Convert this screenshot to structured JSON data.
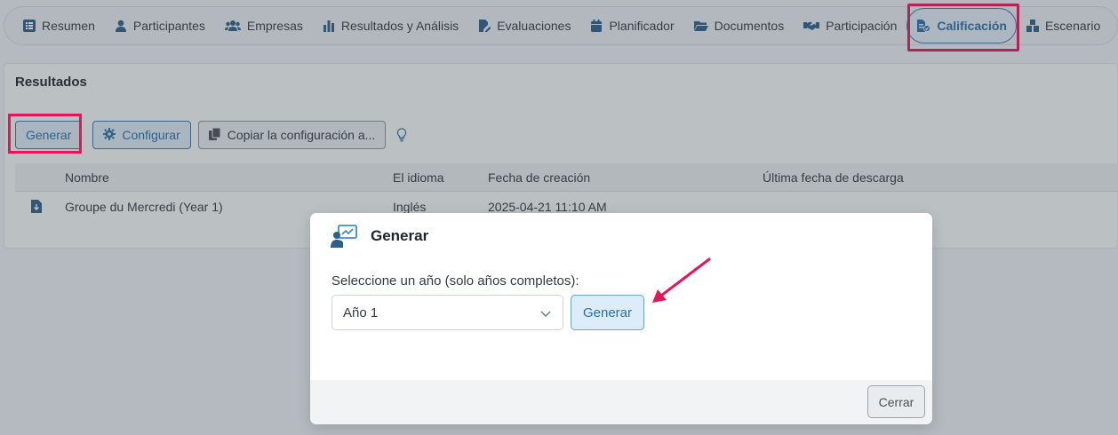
{
  "nav": {
    "items": [
      {
        "label": "Resumen",
        "icon": "list-icon"
      },
      {
        "label": "Participantes",
        "icon": "user-icon"
      },
      {
        "label": "Empresas",
        "icon": "users-icon"
      },
      {
        "label": "Resultados y Análisis",
        "icon": "bar-chart-icon"
      },
      {
        "label": "Evaluaciones",
        "icon": "file-edit-icon"
      },
      {
        "label": "Planificador",
        "icon": "calendar-icon"
      },
      {
        "label": "Documentos",
        "icon": "folder-icon"
      },
      {
        "label": "Participación",
        "icon": "handshake-icon"
      },
      {
        "label": "Calificación",
        "icon": "file-grade-icon",
        "active": true
      },
      {
        "label": "Escenario",
        "icon": "cubes-icon"
      }
    ]
  },
  "results": {
    "title": "Resultados",
    "toolbar": {
      "generate": "Generar",
      "configure": "Configurar",
      "copy_config": "Copiar la configuración a..."
    },
    "columns": [
      "Nombre",
      "El idioma",
      "Fecha de creación",
      "Última fecha de descarga"
    ],
    "rows": [
      {
        "name": "Groupe du Mercredi (Year 1)",
        "language": "Inglés",
        "created": "2025-04-21 11:10 AM",
        "downloaded": ""
      }
    ]
  },
  "modal": {
    "title": "Generar",
    "label": "Seleccione un año (solo años completos):",
    "select_value": "Año 1",
    "generate": "Generar",
    "close": "Cerrar"
  },
  "colors": {
    "accent": "#2d6fa8",
    "highlight": "#e8145a"
  }
}
